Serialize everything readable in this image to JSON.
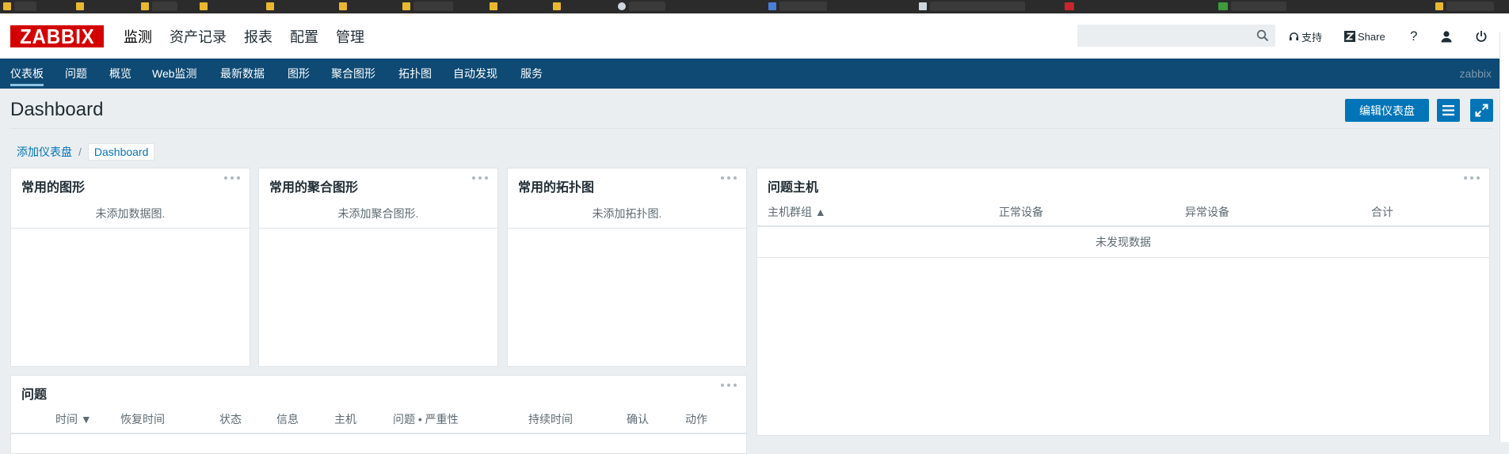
{
  "header": {
    "logo_text": "ZABBIX",
    "main_menu": [
      "监测",
      "资产记录",
      "报表",
      "配置",
      "管理"
    ],
    "search": {
      "value": "",
      "placeholder": ""
    },
    "support_label": "支持",
    "share_label": "Share",
    "help_label": "?"
  },
  "subnav": {
    "items": [
      "仪表板",
      "问题",
      "概览",
      "Web监测",
      "最新数据",
      "图形",
      "聚合图形",
      "拓扑图",
      "自动发现",
      "服务"
    ],
    "active_index": 0,
    "user": "zabbix"
  },
  "page": {
    "title": "Dashboard",
    "edit_button": "编辑仪表盘"
  },
  "breadcrumb": {
    "parent": "添加仪表盘",
    "separator": "/",
    "current": "Dashboard"
  },
  "widgets": {
    "fav_graphs": {
      "title": "常用的图形",
      "empty": "未添加数据图."
    },
    "fav_screens": {
      "title": "常用的聚合图形",
      "empty": "未添加聚合图形."
    },
    "fav_maps": {
      "title": "常用的拓扑图",
      "empty": "未添加拓扑图."
    },
    "problem_hosts": {
      "title": "问题主机",
      "columns": [
        "主机群组 ▲",
        "正常设备",
        "异常设备",
        "合计"
      ],
      "empty": "未发现数据"
    },
    "problems": {
      "title": "问题",
      "columns": [
        "时间 ▼",
        "恢复时间",
        "状态",
        "信息",
        "主机",
        "问题 • 严重性",
        "持续时间",
        "确认",
        "动作"
      ]
    }
  },
  "colors": {
    "brand_red": "#d40000",
    "nav_blue": "#0e4a74",
    "button_blue": "#0275b8",
    "page_bg": "#ebeef0"
  }
}
